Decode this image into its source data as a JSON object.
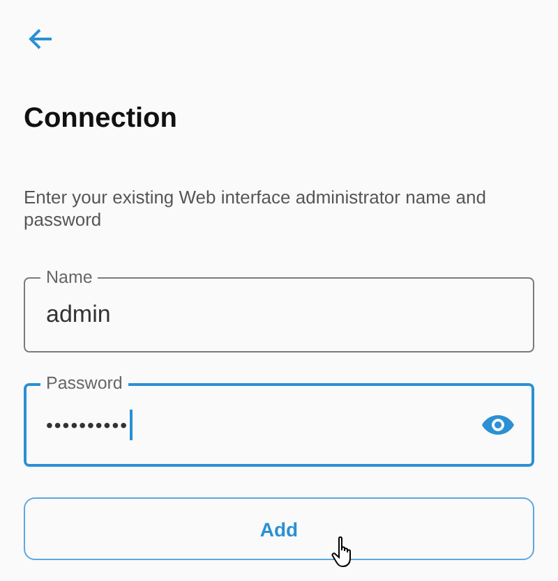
{
  "title": "Connection",
  "description": "Enter your existing Web interface administrator name and password",
  "fields": [
    {
      "kind": "text",
      "label": "Name",
      "value": "admin",
      "focused": false
    },
    {
      "kind": "password",
      "label": "Password",
      "value": "••••••••••",
      "focused": true
    }
  ],
  "button": {
    "label": "Add"
  }
}
